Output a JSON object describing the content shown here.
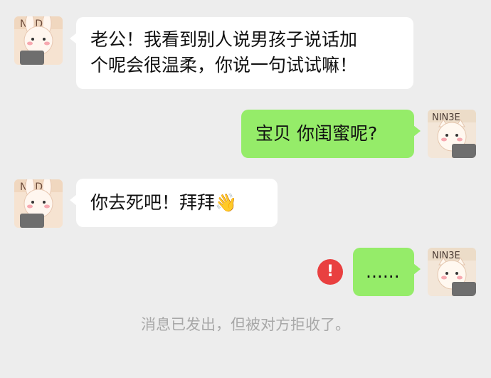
{
  "colors": {
    "background": "#ededed",
    "incoming_bubble": "#ffffff",
    "outgoing_bubble": "#95ec69",
    "error": "#e94040",
    "system_text": "#a8a8a8"
  },
  "messages": [
    {
      "sender": "other",
      "text": "老公！我看到别人说男孩子说话加\n个呢会很温柔，你说一句试试嘛！"
    },
    {
      "sender": "self",
      "text": "宝贝 你闺蜜呢?"
    },
    {
      "sender": "other",
      "text": "你去死吧！拜拜👋"
    },
    {
      "sender": "self",
      "text": "......",
      "status": "rejected",
      "status_icon": "exclamation-icon",
      "status_symbol": "!"
    }
  ],
  "system_notice": "消息已发出，但被对方拒收了。",
  "avatars": {
    "other": {
      "icon": "bunny-avatar-icon",
      "text": "NDDO"
    },
    "self": {
      "icon": "cat-avatar-icon",
      "text": "NIN3E"
    }
  }
}
